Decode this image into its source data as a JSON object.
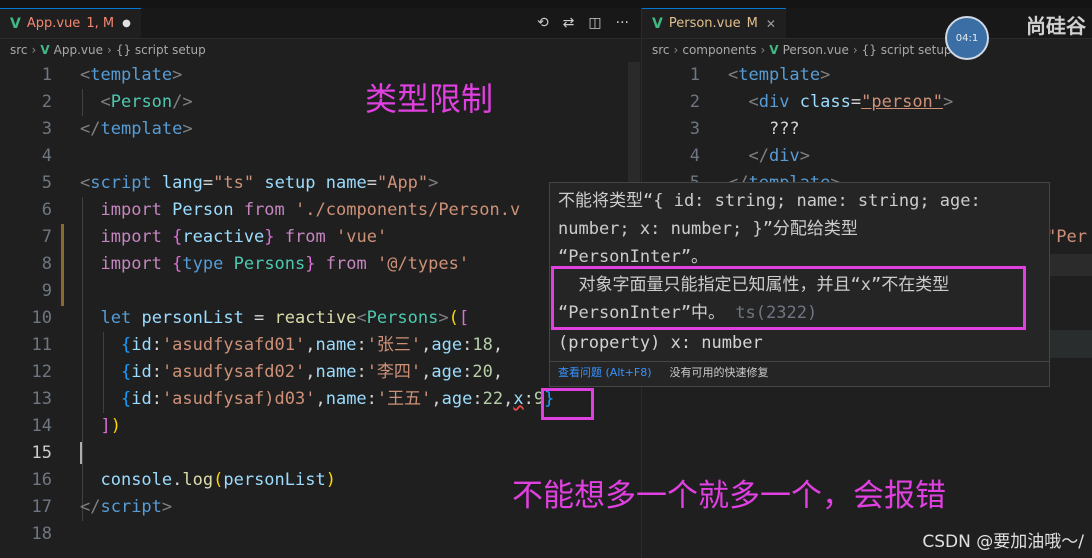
{
  "left_editor": {
    "tab": {
      "filename": "App.vue",
      "status": "1, M"
    },
    "breadcrumb": [
      "src",
      "App.vue",
      "{} script setup"
    ],
    "lines": [
      {
        "n": "1"
      },
      {
        "n": "2"
      },
      {
        "n": "3"
      },
      {
        "n": "4"
      },
      {
        "n": "5"
      },
      {
        "n": "6"
      },
      {
        "n": "7"
      },
      {
        "n": "8"
      },
      {
        "n": "9"
      },
      {
        "n": "10"
      },
      {
        "n": "11"
      },
      {
        "n": "12"
      },
      {
        "n": "13"
      },
      {
        "n": "14"
      },
      {
        "n": "15"
      },
      {
        "n": "16"
      },
      {
        "n": "17"
      },
      {
        "n": "18"
      }
    ],
    "code": {
      "l1_tag": "template",
      "l2_comp": "Person",
      "l3_tag": "template",
      "l5_tag": "script",
      "l5_lang_attr": "lang",
      "l5_lang_val": "\"ts\"",
      "l5_setup": "setup",
      "l5_name_attr": "name",
      "l5_name_val": "\"App\"",
      "l6_import": "import",
      "l6_name": "Person",
      "l6_from": "from",
      "l6_path": "'./components/Person.v",
      "l7_import": "import",
      "l7_name": "reactive",
      "l7_from": "from",
      "l7_path": "'vue'",
      "l8_import": "import",
      "l8_type": "type",
      "l8_name": "Persons",
      "l8_from": "from",
      "l8_path": "'@/types'",
      "l10_let": "let",
      "l10_var": "personList",
      "l10_eq": " = ",
      "l10_fn": "reactive",
      "l10_type": "Persons",
      "l11_id": "'asudfysafd01'",
      "l11_name": "'张三'",
      "l11_age": "18",
      "l12_id": "'asudfysafd02'",
      "l12_name": "'李四'",
      "l12_age": "20",
      "l13_id": "'asudfysaf)d03'",
      "l13_name": "'王五'",
      "l13_age": "22",
      "l13_x": "9",
      "l16_obj": "console",
      "l16_fn": "log",
      "l16_arg": "personList",
      "l17_tag": "script",
      "k_id": "id",
      "k_name": "name",
      "k_age": "age",
      "k_x": "x"
    }
  },
  "right_editor": {
    "tab": {
      "filename": "Person.vue",
      "status": "M"
    },
    "breadcrumb": [
      "src",
      "components",
      "Person.vue",
      "{} script setup"
    ],
    "lines": [
      {
        "n": "1"
      },
      {
        "n": "2"
      },
      {
        "n": "3"
      },
      {
        "n": "4"
      },
      {
        "n": "5"
      }
    ],
    "code": {
      "l1_tag": "template",
      "l2_tag": "div",
      "l2_attr": "class",
      "l2_val": "\"person\"",
      "l3_text": "???",
      "l4_tag": "div",
      "l5_tag": "template",
      "l8_str": "\"Per"
    }
  },
  "hover": {
    "message_line1": "不能将类型“{ id: string; name: string; age:",
    "message_line2": "number; x: number; }”分配给类型",
    "message_line3": "“PersonInter”。",
    "detail_line1": "  对象字面量只能指定已知属性，并且“x”不在类型",
    "detail_line2": "“PersonInter”中。",
    "detail_code": "ts(2322)",
    "property": "(property) x: number",
    "view_problem": "查看问题 (Alt+F8)",
    "no_quick_fix": "没有可用的快速修复"
  },
  "annotations": {
    "title": "类型限制",
    "note": "不能想多一个就多一个，会报错",
    "highlight_color": "#e040e0"
  },
  "watermark": "CSDN @要加油哦～/",
  "corner_text": "尚硅谷",
  "avatar_text": "04:1"
}
